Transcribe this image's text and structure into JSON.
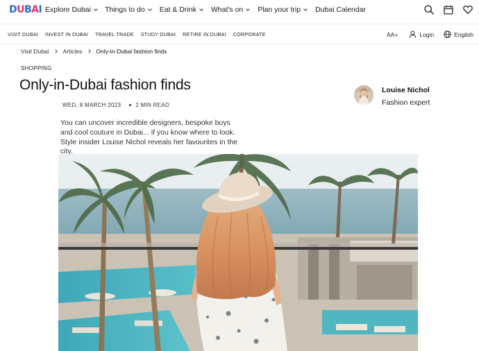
{
  "brand": {
    "logo_letters": [
      "D",
      "U",
      "B",
      "A",
      "I"
    ]
  },
  "main_nav": [
    {
      "label": "Explore Dubai",
      "has_dropdown": true
    },
    {
      "label": "Things to do",
      "has_dropdown": true
    },
    {
      "label": "Eat & Drink",
      "has_dropdown": true
    },
    {
      "label": "What's on",
      "has_dropdown": true
    },
    {
      "label": "Plan your trip",
      "has_dropdown": true
    },
    {
      "label": "Dubai Calendar",
      "has_dropdown": false
    }
  ],
  "top_icons": [
    "search-icon",
    "calendar-icon",
    "heart-icon"
  ],
  "secondary_nav": {
    "links": [
      "VISIT DUBAI",
      "INVEST IN DUBAI",
      "TRAVEL TRADE",
      "STUDY DUBAI",
      "RETIRE IN DUBAI",
      "CORPORATE"
    ],
    "text_size": "AA+",
    "login": "Login",
    "language": "English"
  },
  "breadcrumb": {
    "items": [
      "Visit Dubai",
      "Articles"
    ],
    "current": "Only-in-Dubai fashion finds"
  },
  "article": {
    "category": "SHOPPING",
    "title": "Only-in-Dubai fashion finds",
    "date": "WED, 8 MARCH 2023",
    "read_time": "2 MIN READ",
    "intro": "You can uncover incredible designers, bespoke buys and cool couture in Dubai... if you know where to look. Style insider Louise Nichol reveals her favourites in the city."
  },
  "author": {
    "name": "Louise Nichol",
    "role": "Fashion expert"
  },
  "colors": {
    "logo_blue": "#1d6fd1",
    "logo_pink": "#e2316e",
    "text": "#1a1a1a",
    "divider": "#ececec"
  }
}
